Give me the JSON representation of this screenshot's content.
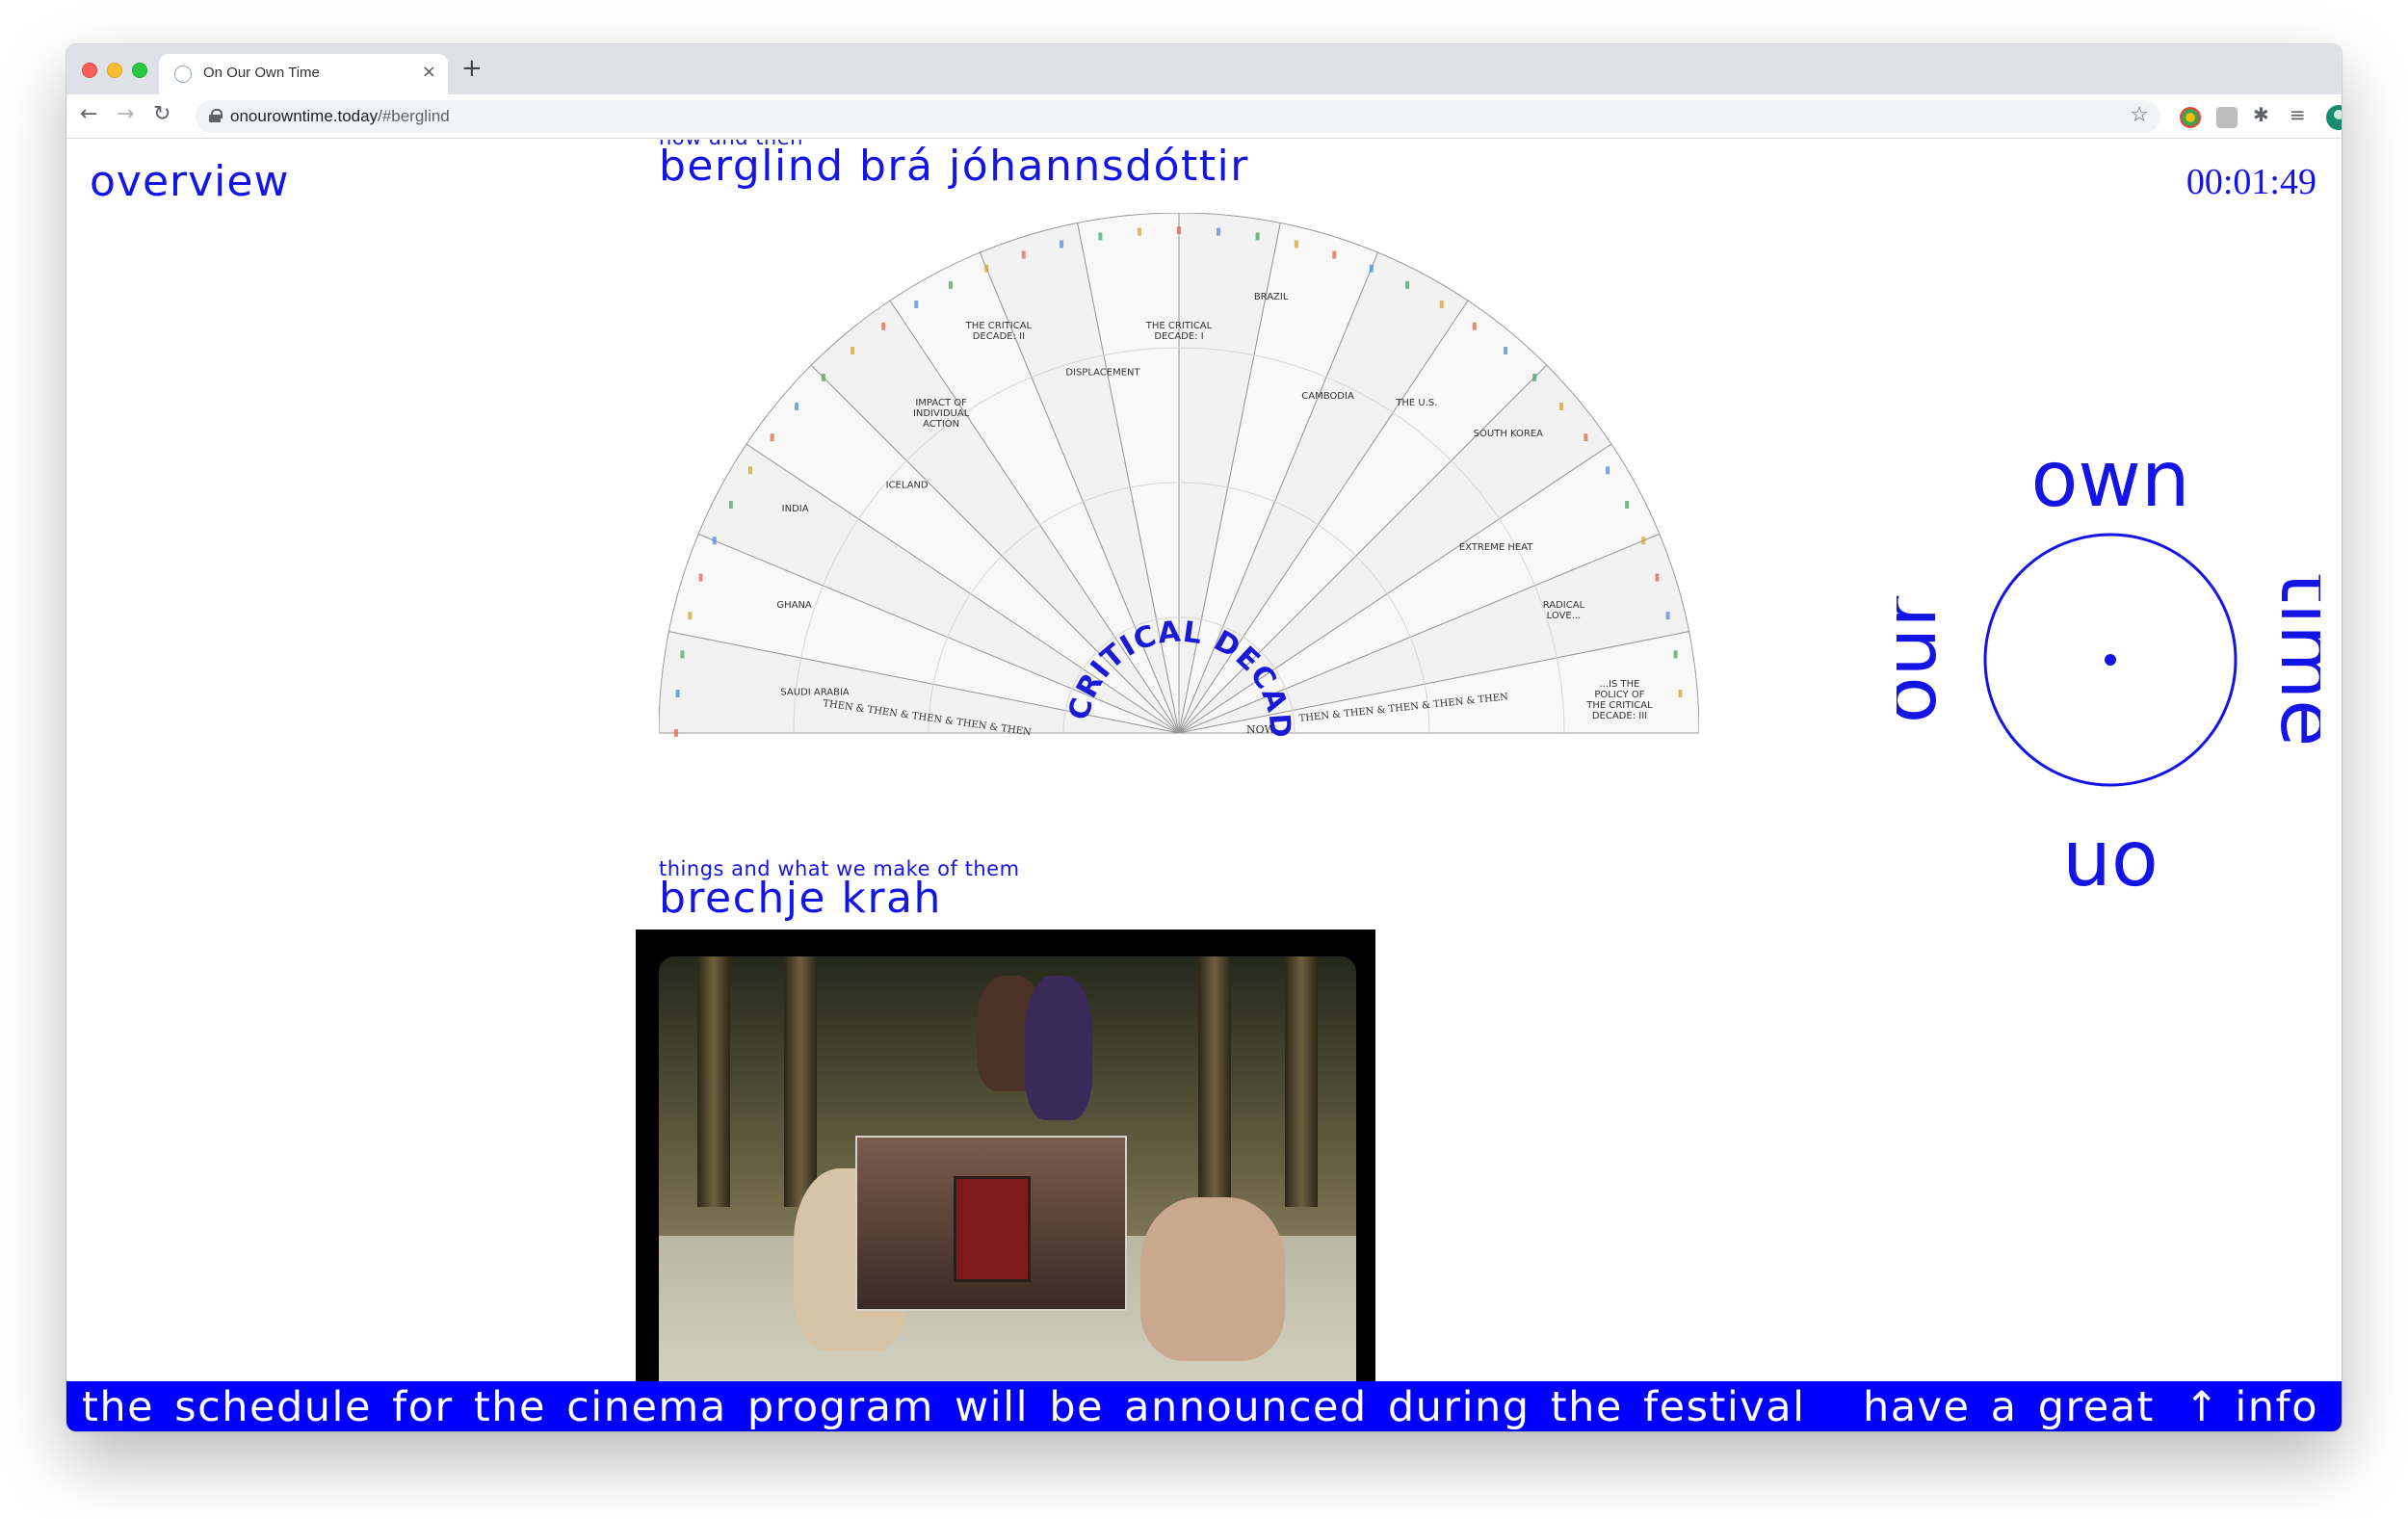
{
  "browser": {
    "tab_title": "On Our Own Time",
    "tab_close": "×",
    "new_tab": "+",
    "url_host": "onourowntime.today",
    "url_path": "/#berglind",
    "back": "←",
    "forward": "→",
    "reload": "↻",
    "star": "☆",
    "menu": "⋮",
    "ext_puzzle": "✱",
    "ext_media": "≡"
  },
  "page": {
    "overview_label": "overview",
    "clock": "00:01:49",
    "projects": [
      {
        "subtitle": "now and then",
        "title": "berglind brá jóhannsdóttir",
        "chart_labels": [
          "SAUDI ARABIA",
          "GHANA",
          "INDIA",
          "ICELAND",
          "IMPACT OF INDIVIDUAL ACTION",
          "THE CRITICAL DECADE: II",
          "DISPLACEMENT",
          "THE CRITICAL DECADE: I",
          "BRAZIL",
          "CAMBODIA",
          "THE U.S.",
          "SOUTH KOREA",
          "EXTREME HEAT",
          "RADICAL LOVE...",
          "...IS THE POLICY OF THE CRITICAL DECADE: III"
        ],
        "center_text": "CRITICAL DECADE",
        "repeat_word": "THEN & THEN & THEN & THEN & THEN",
        "now_word": "NOW"
      },
      {
        "subtitle": "things and what we make of them",
        "title": "brechje krah"
      }
    ],
    "logo_words": {
      "top": "own",
      "right": "time",
      "bottom": "on",
      "left": "our"
    },
    "ticker": {
      "message": "the schedule for the cinema program will be announced during the festival",
      "message_2": "have a great",
      "info_label": "↑ info"
    }
  },
  "colors": {
    "accent": "#0000ff",
    "text_blue": "#1414e6"
  }
}
